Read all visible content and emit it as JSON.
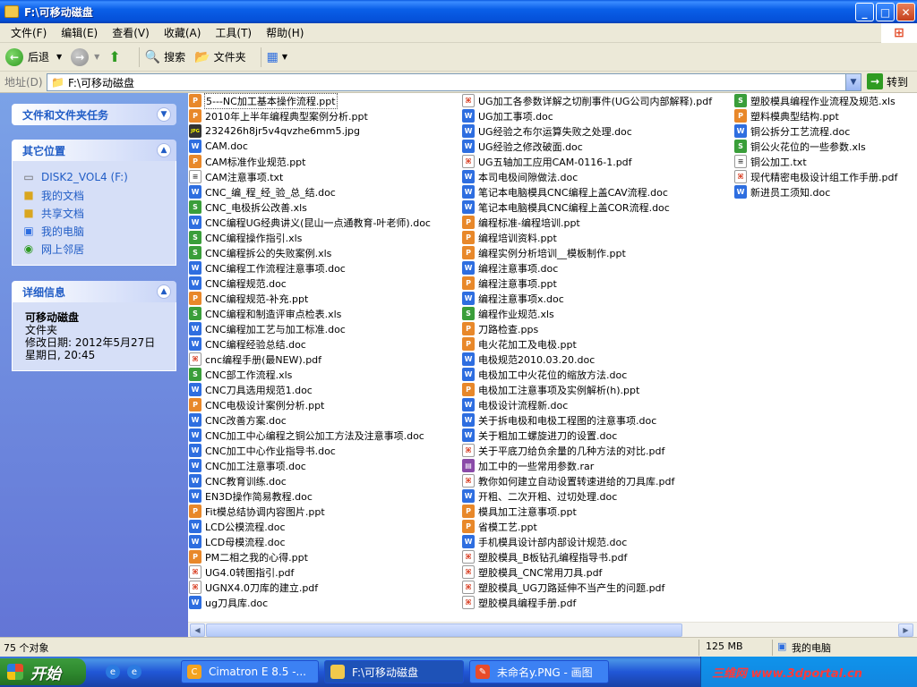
{
  "window": {
    "title": "F:\\可移动磁盘",
    "controls": {
      "minimize": "_",
      "maximize": "□",
      "close": "✕"
    }
  },
  "menu": [
    {
      "label": "文件(F)"
    },
    {
      "label": "编辑(E)"
    },
    {
      "label": "查看(V)"
    },
    {
      "label": "收藏(A)"
    },
    {
      "label": "工具(T)"
    },
    {
      "label": "帮助(H)"
    }
  ],
  "toolbar": {
    "back": "后退",
    "search": "搜索",
    "folders": "文件夹"
  },
  "address": {
    "label": "地址(D)",
    "value": "F:\\可移动磁盘",
    "go": "转到"
  },
  "tasks_panel": {
    "title": "文件和文件夹任务"
  },
  "other_places": {
    "title": "其它位置",
    "items": [
      {
        "label": "DISK2_VOL4 (F:)",
        "icon": "drive-icon"
      },
      {
        "label": "我的文档",
        "icon": "folder-icon"
      },
      {
        "label": "共享文档",
        "icon": "folder-icon"
      },
      {
        "label": "我的电脑",
        "icon": "computer-icon"
      },
      {
        "label": "网上邻居",
        "icon": "network-icon"
      }
    ]
  },
  "details": {
    "title": "详细信息",
    "name": "可移动磁盘",
    "type": "文件夹",
    "modified_line1": "修改日期: 2012年5月27日",
    "modified_line2": "星期日, 20:45"
  },
  "files": {
    "col1": [
      {
        "name": "5---NC加工基本操作流程.ppt",
        "type": "ppt"
      },
      {
        "name": "2010年上半年编程典型案例分析.ppt",
        "type": "ppt"
      },
      {
        "name": "232426h8jr5v4qvzhe6mm5.jpg",
        "type": "jpg"
      },
      {
        "name": "CAM.doc",
        "type": "doc"
      },
      {
        "name": "CAM标准作业规范.ppt",
        "type": "ppt"
      },
      {
        "name": "CAM注意事项.txt",
        "type": "txt"
      },
      {
        "name": "CNC_编_程_经_验_总_结.doc",
        "type": "doc"
      },
      {
        "name": "CNC_电极拆公改善.xls",
        "type": "xls"
      },
      {
        "name": "CNC编程UG经典讲义(昆山一点通教育-叶老师).doc",
        "type": "doc"
      },
      {
        "name": "CNC编程操作指引.xls",
        "type": "xls"
      },
      {
        "name": "CNC编程拆公的失败案例.xls",
        "type": "xls"
      },
      {
        "name": "CNC编程工作流程注意事项.doc",
        "type": "doc"
      },
      {
        "name": "CNC编程规范.doc",
        "type": "doc"
      },
      {
        "name": "CNC编程规范-补充.ppt",
        "type": "ppt"
      },
      {
        "name": "CNC编程和制造评审点检表.xls",
        "type": "xls"
      },
      {
        "name": "CNC编程加工艺与加工标准.doc",
        "type": "doc"
      },
      {
        "name": "CNC编程经验总结.doc",
        "type": "doc"
      },
      {
        "name": "cnc编程手册(最NEW).pdf",
        "type": "pdf"
      },
      {
        "name": "CNC部工作流程.xls",
        "type": "xls"
      },
      {
        "name": "CNC刀具选用规范1.doc",
        "type": "doc"
      },
      {
        "name": "CNC电极设计案例分析.ppt",
        "type": "ppt"
      },
      {
        "name": "CNC改善方案.doc",
        "type": "doc"
      },
      {
        "name": "CNC加工中心编程之铜公加工方法及注意事项.doc",
        "type": "doc"
      },
      {
        "name": "CNC加工中心作业指导书.doc",
        "type": "doc"
      },
      {
        "name": "CNC加工注意事项.doc",
        "type": "doc"
      },
      {
        "name": "CNC教育训练.doc",
        "type": "doc"
      },
      {
        "name": "EN3D操作简易教程.doc",
        "type": "doc"
      },
      {
        "name": "Fit模总结协调内容图片.ppt",
        "type": "ppt"
      },
      {
        "name": "LCD公模流程.doc",
        "type": "doc"
      },
      {
        "name": "LCD母模流程.doc",
        "type": "doc"
      },
      {
        "name": "PM二相之我的心得.ppt",
        "type": "ppt"
      },
      {
        "name": "UG4.0转图指引.pdf",
        "type": "pdf"
      },
      {
        "name": "UGNX4.0刀库的建立.pdf",
        "type": "pdf"
      },
      {
        "name": "ug刀具库.doc",
        "type": "doc"
      }
    ],
    "col2": [
      {
        "name": "UG加工各参数详解之切削事件(UG公司内部解释).pdf",
        "type": "pdf"
      },
      {
        "name": "UG加工事项.doc",
        "type": "doc"
      },
      {
        "name": "UG经验之布尔运算失败之处理.doc",
        "type": "doc"
      },
      {
        "name": "UG经验之修改破面.doc",
        "type": "doc"
      },
      {
        "name": "UG五轴加工应用CAM-0116-1.pdf",
        "type": "pdf"
      },
      {
        "name": "本司电极间隙做法.doc",
        "type": "doc"
      },
      {
        "name": "笔记本电脑模具CNC编程上盖CAV流程.doc",
        "type": "doc"
      },
      {
        "name": "笔记本电脑模具CNC编程上盖COR流程.doc",
        "type": "doc"
      },
      {
        "name": "编程标准-编程培训.ppt",
        "type": "ppt"
      },
      {
        "name": "编程培训资料.ppt",
        "type": "ppt"
      },
      {
        "name": "编程实例分析培训__模板制作.ppt",
        "type": "ppt"
      },
      {
        "name": "编程注意事项.doc",
        "type": "doc"
      },
      {
        "name": "编程注意事项.ppt",
        "type": "ppt"
      },
      {
        "name": "编程注意事项x.doc",
        "type": "doc"
      },
      {
        "name": "编程作业规范.xls",
        "type": "xls"
      },
      {
        "name": "刀路检查.pps",
        "type": "pps"
      },
      {
        "name": "电火花加工及电极.ppt",
        "type": "ppt"
      },
      {
        "name": "电极规范2010.03.20.doc",
        "type": "doc"
      },
      {
        "name": "电极加工中火花位的缩放方法.doc",
        "type": "doc"
      },
      {
        "name": "电极加工注意事项及实例解析(h).ppt",
        "type": "ppt"
      },
      {
        "name": "电极设计流程新.doc",
        "type": "doc"
      },
      {
        "name": "关于拆电极和电极工程图的注意事项.doc",
        "type": "doc"
      },
      {
        "name": "关于粗加工螺旋进刀的设置.doc",
        "type": "doc"
      },
      {
        "name": "关于平底刀给负余量的几种方法的对比.pdf",
        "type": "pdf"
      },
      {
        "name": "加工中的一些常用参数.rar",
        "type": "rar"
      },
      {
        "name": "教你如何建立自动设置转速进给的刀具库.pdf",
        "type": "pdf"
      },
      {
        "name": "开粗、二次开粗、过切处理.doc",
        "type": "doc"
      },
      {
        "name": "模具加工注意事项.ppt",
        "type": "ppt"
      },
      {
        "name": "省模工艺.ppt",
        "type": "ppt"
      },
      {
        "name": "手机模具设计部内部设计规范.doc",
        "type": "doc"
      },
      {
        "name": "塑胶模具_B板钻孔编程指导书.pdf",
        "type": "pdf"
      },
      {
        "name": "塑胶模具_CNC常用刀具.pdf",
        "type": "pdf"
      },
      {
        "name": "塑胶模具_UG刀路延伸不当产生的问题.pdf",
        "type": "pdf"
      },
      {
        "name": "塑胶模具编程手册.pdf",
        "type": "pdf"
      }
    ],
    "col3": [
      {
        "name": "塑胶模具编程作业流程及规范.xls",
        "type": "xls"
      },
      {
        "name": "塑料模典型结构.ppt",
        "type": "ppt"
      },
      {
        "name": "铜公拆分工艺流程.doc",
        "type": "doc"
      },
      {
        "name": "铜公火花位的一些参数.xls",
        "type": "xls"
      },
      {
        "name": "铜公加工.txt",
        "type": "txt"
      },
      {
        "name": "现代精密电极设计组工作手册.pdf",
        "type": "pdf"
      },
      {
        "name": "新进员工须知.doc",
        "type": "doc"
      }
    ]
  },
  "status": {
    "count": "75 个对象",
    "size": "125 MB",
    "location": "我的电脑"
  },
  "taskbar": {
    "start": "开始",
    "tasks": [
      {
        "label": "Cimatron E 8.5 -...",
        "active": false
      },
      {
        "label": "F:\\可移动磁盘",
        "active": true
      },
      {
        "label": "未命名y.PNG - 画图",
        "active": false
      }
    ],
    "watermark": "三维网 www.3dportal.cn"
  },
  "colors": {
    "titlebar": "#0a5fe8",
    "taskpane": "#7ba2e7",
    "link": "#215dc6",
    "taskbar": "#2157d7",
    "start": "#2f8a2f"
  }
}
